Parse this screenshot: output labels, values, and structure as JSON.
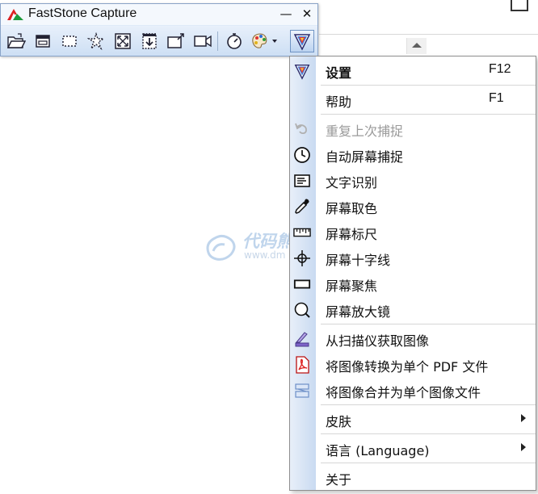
{
  "toolbar": {
    "title": "FastStone Capture",
    "minimize_glyph": "—",
    "close_glyph": "✕",
    "tools": [
      {
        "icon": "open-file-icon"
      },
      {
        "icon": "capture-window-icon"
      },
      {
        "icon": "capture-rect-icon"
      },
      {
        "icon": "capture-freehand-icon"
      },
      {
        "icon": "capture-fullscreen-icon"
      },
      {
        "icon": "capture-scroll-icon"
      },
      {
        "icon": "capture-fixed-region-icon"
      },
      {
        "icon": "screen-recorder-icon"
      },
      {
        "icon": "delay-timer-icon"
      },
      {
        "icon": "output-palette-icon"
      },
      {
        "icon": "settings-menu-icon"
      }
    ]
  },
  "menu": {
    "items": [
      {
        "id": "settings",
        "label": "设置",
        "shortcut": "F12",
        "icon": "settings-icon",
        "bold": true
      },
      {
        "id": "help",
        "label": "帮助",
        "shortcut": "F1"
      },
      {
        "id": "repeat-last",
        "label": "重复上次捕捉",
        "icon": "undo-arrow-icon",
        "disabled": true
      },
      {
        "id": "auto-capture",
        "label": "自动屏幕捕捉",
        "icon": "clock-icon"
      },
      {
        "id": "ocr",
        "label": "文字识别",
        "icon": "ocr-icon"
      },
      {
        "id": "color-picker",
        "label": "屏幕取色",
        "icon": "eyedropper-icon"
      },
      {
        "id": "ruler",
        "label": "屏幕标尺",
        "icon": "ruler-icon"
      },
      {
        "id": "crosshair",
        "label": "屏幕十字线",
        "icon": "crosshair-icon"
      },
      {
        "id": "focus",
        "label": "屏幕聚焦",
        "icon": "focus-rect-icon"
      },
      {
        "id": "magnifier",
        "label": "屏幕放大镜",
        "icon": "magnifier-icon"
      },
      {
        "id": "scanner",
        "label": "从扫描仪获取图像",
        "icon": "scanner-icon"
      },
      {
        "id": "to-pdf",
        "label": "将图像转换为单个 PDF 文件",
        "icon": "pdf-icon"
      },
      {
        "id": "combine",
        "label": "将图像合并为单个图像文件",
        "icon": "combine-images-icon"
      },
      {
        "id": "skin",
        "label": "皮肤",
        "submenu": true
      },
      {
        "id": "language",
        "label": "语言 (Language)",
        "submenu": true
      },
      {
        "id": "about",
        "label": "关于"
      }
    ]
  },
  "watermark": {
    "title": "代码熊网",
    "url": "www.dm"
  },
  "colors": {
    "accent": "#2b6fd1",
    "gutter": "#c9daf1",
    "disabled": "#9a9a9a"
  }
}
